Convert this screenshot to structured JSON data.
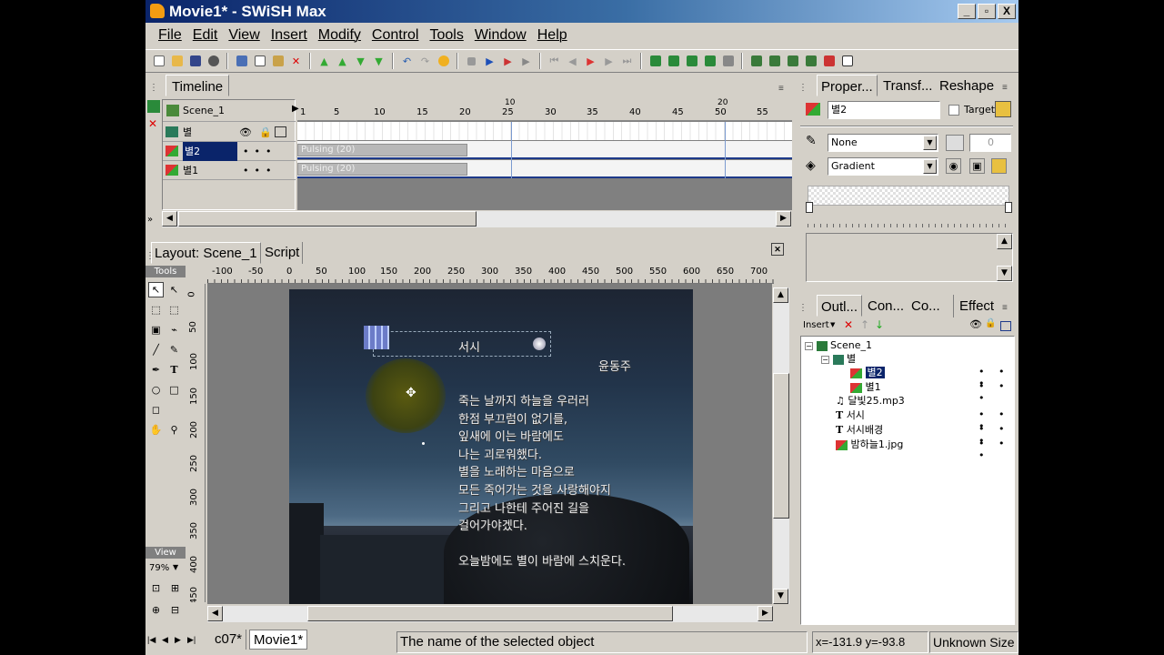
{
  "window": {
    "title": "Movie1* - SWiSH Max",
    "min": "_",
    "max": "▫",
    "close": "X"
  },
  "menu": [
    "File",
    "Edit",
    "View",
    "Insert",
    "Modify",
    "Control",
    "Tools",
    "Window",
    "Help"
  ],
  "timeline": {
    "title": "Timeline",
    "scene": "Scene_1",
    "frame_numbers": [
      "1",
      "5",
      "10",
      "15",
      "20",
      "25",
      "30",
      "35",
      "40",
      "45",
      "50",
      "55"
    ],
    "frame_markers": [
      "10",
      "20"
    ],
    "layers": [
      {
        "name": "별",
        "tween": ""
      },
      {
        "name": "별2",
        "tween": "Pulsing (20)"
      },
      {
        "name": "별1",
        "tween": "Pulsing (20)"
      }
    ]
  },
  "layout": {
    "tab_layout": "Layout: Scene_1",
    "tab_script": "Script",
    "tools_label": "Tools",
    "view_label": "View",
    "zoom": "79%",
    "ruler_h": [
      "-100",
      "-50",
      "0",
      "50",
      "100",
      "150",
      "200",
      "250",
      "300",
      "350",
      "400",
      "450",
      "500",
      "550",
      "600",
      "650",
      "700"
    ],
    "ruler_v": [
      "0",
      "50",
      "100",
      "150",
      "200",
      "250",
      "300",
      "350",
      "400",
      "450"
    ]
  },
  "canvas": {
    "title": "서시",
    "author": "윤동주",
    "poem": [
      "죽는 날까지 하늘을 우러러",
      "한점 부끄럼이 없기를,",
      "잎새에 이는 바람에도",
      "나는 괴로워했다.",
      "별을 노래하는 마음으로",
      "모든 죽어가는 것을 사랑해야지",
      "그리고 나한테 주어진 길을",
      "걸어가야겠다."
    ],
    "last_line": "오늘밤에도 별이 바람에 스치운다."
  },
  "properties": {
    "tabs": [
      "Proper...",
      "Transf...",
      "Reshape"
    ],
    "name_value": "별2",
    "target_label": "Target",
    "line_value": "None",
    "fill_value": "Gradient",
    "spin_value": "0"
  },
  "outline": {
    "tabs": [
      "Outl...",
      "Con...",
      "Co...",
      "Effect"
    ],
    "insert_label": "Insert",
    "items": [
      {
        "label": "Scene_1",
        "dots": ""
      },
      {
        "label": "별",
        "dots": ""
      },
      {
        "label": "별2",
        "dots": "• • •"
      },
      {
        "label": "별1",
        "dots": "• • •"
      },
      {
        "label": "달빛25.mp3",
        "dots": ""
      },
      {
        "label": "서시",
        "dots": "• • •"
      },
      {
        "label": "서시배경",
        "dots": "• • •"
      },
      {
        "label": "밤하늘1.jpg",
        "dots": "• • •"
      }
    ]
  },
  "statusbar": {
    "tab1": "c07*",
    "tab2": "Movie1*",
    "message": "The name of the selected object",
    "coords": "x=-131.9 y=-93.8",
    "size": "Unknown Size"
  }
}
